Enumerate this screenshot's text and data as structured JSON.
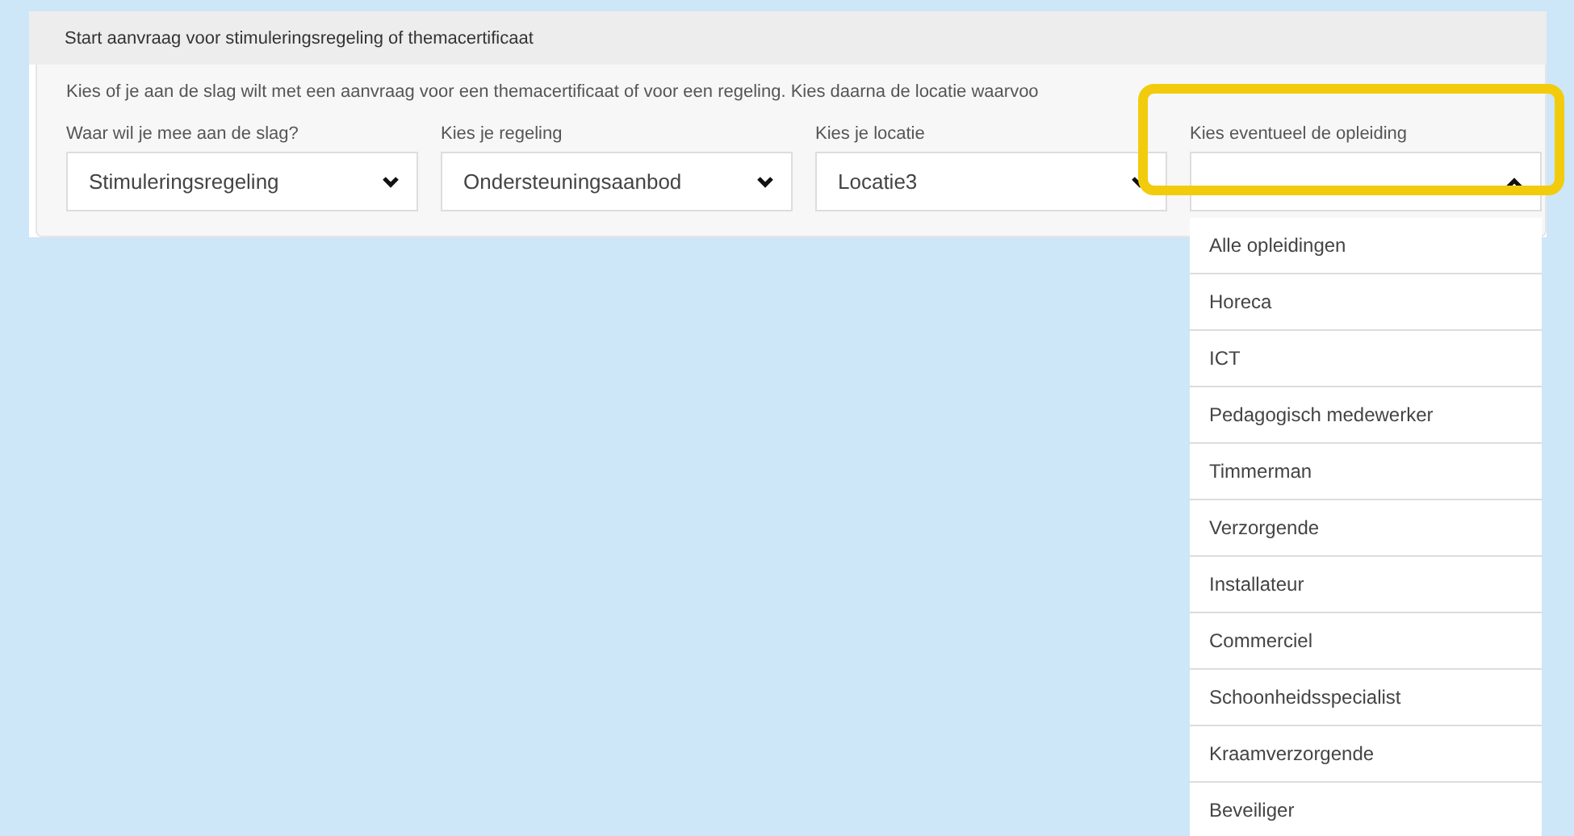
{
  "panel": {
    "title": "Start aanvraag voor stimuleringsregeling of themacertificaat",
    "description": "Kies of je aan de slag wilt met een aanvraag voor een themacertificaat of voor een regeling. Kies daarna de locatie waarvoo"
  },
  "fields": [
    {
      "label": "Waar wil je mee aan de slag?",
      "value": "Stimuleringsregeling",
      "expanded": false
    },
    {
      "label": "Kies je regeling",
      "value": "Ondersteuningsaanbod",
      "expanded": false
    },
    {
      "label": "Kies je locatie",
      "value": "Locatie3",
      "expanded": false
    },
    {
      "label": "Kies eventueel de opleiding",
      "expanded": true,
      "highlighted": true,
      "options": [
        "Alle opleidingen",
        "Horeca",
        "ICT",
        "Pedagogisch medewerker",
        "Timmerman",
        "Verzorgende",
        "Installateur",
        "Commerciel",
        "Schoonheidsspecialist",
        "Kraamverzorgende",
        "Beveiliger"
      ]
    }
  ]
}
